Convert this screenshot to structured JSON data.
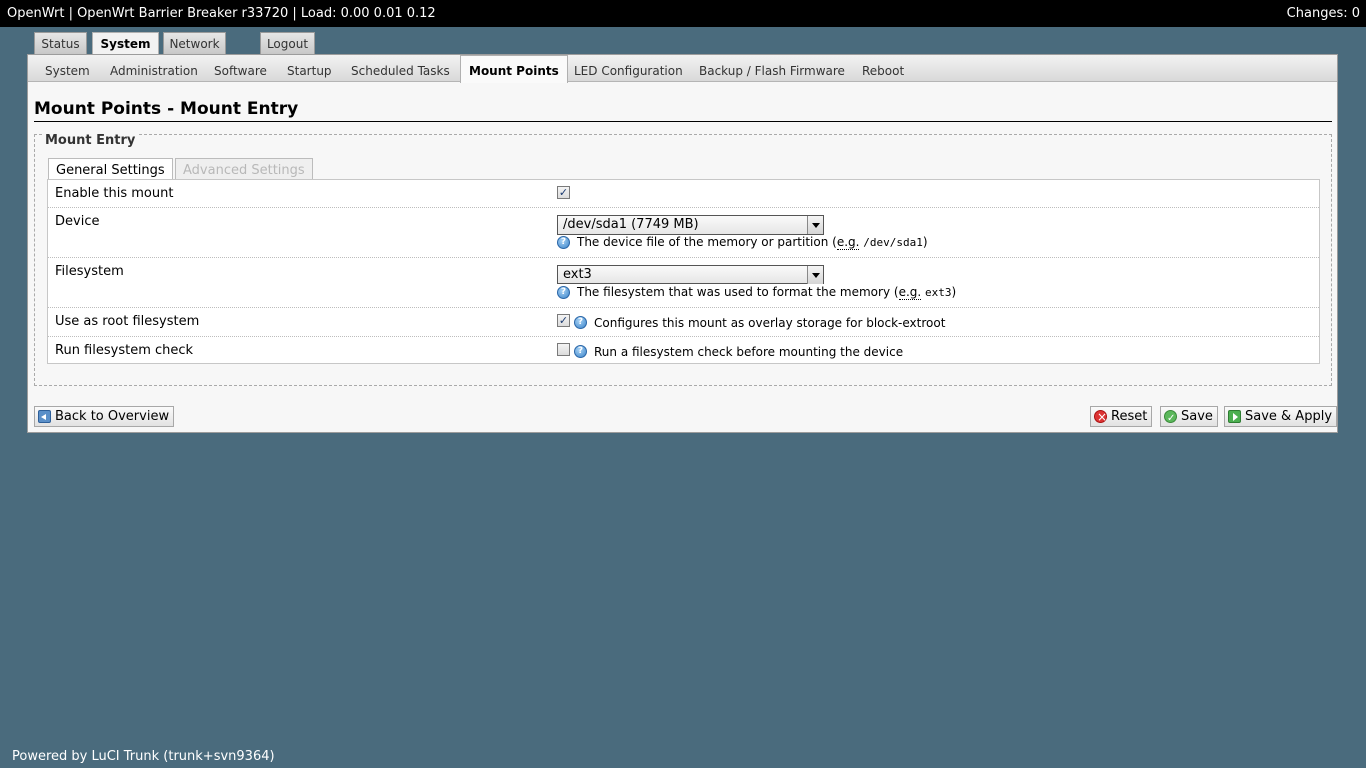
{
  "header": {
    "title": "OpenWrt | OpenWrt Barrier Breaker r33720 | Load: 0.00 0.01 0.12",
    "changes": "Changes: 0"
  },
  "main_tabs": [
    {
      "label": "Status",
      "active": false
    },
    {
      "label": "System",
      "active": true
    },
    {
      "label": "Network",
      "active": false
    },
    {
      "label": "Logout",
      "active": false
    }
  ],
  "sub_nav": [
    {
      "label": "System"
    },
    {
      "label": "Administration"
    },
    {
      "label": "Software"
    },
    {
      "label": "Startup"
    },
    {
      "label": "Scheduled Tasks"
    },
    {
      "label": "Mount Points",
      "active": true
    },
    {
      "label": "LED Configuration"
    },
    {
      "label": "Backup / Flash Firmware"
    },
    {
      "label": "Reboot"
    }
  ],
  "page": {
    "title": "Mount Points - Mount Entry",
    "section_legend": "Mount Entry",
    "section_tabs": [
      {
        "label": "General Settings",
        "active": true
      },
      {
        "label": "Advanced Settings",
        "active": false
      }
    ]
  },
  "form": {
    "enable": {
      "label": "Enable this mount",
      "checked": true
    },
    "device": {
      "label": "Device",
      "value": "/dev/sda1 (7749 MB)",
      "help_text": "The device file of the memory or partition (",
      "help_abbr": "e.g.",
      "help_code": "/dev/sda1",
      "help_close": ")"
    },
    "filesystem": {
      "label": "Filesystem",
      "value": "ext3",
      "help_text": "The filesystem that was used to format the memory (",
      "help_abbr": "e.g.",
      "help_code": "ext3",
      "help_close": ")"
    },
    "root": {
      "label": "Use as root filesystem",
      "checked": true,
      "desc": "Configures this mount as overlay storage for block-extroot"
    },
    "fsck": {
      "label": "Run filesystem check",
      "checked": false,
      "desc": "Run a filesystem check before mounting the device"
    }
  },
  "buttons": {
    "back": "Back to Overview",
    "reset": "Reset",
    "save": "Save",
    "save_apply": "Save & Apply"
  },
  "footer": "Powered by LuCI Trunk (trunk+svn9364)",
  "icons": {
    "help": "help-icon",
    "check_mark": "✓"
  }
}
